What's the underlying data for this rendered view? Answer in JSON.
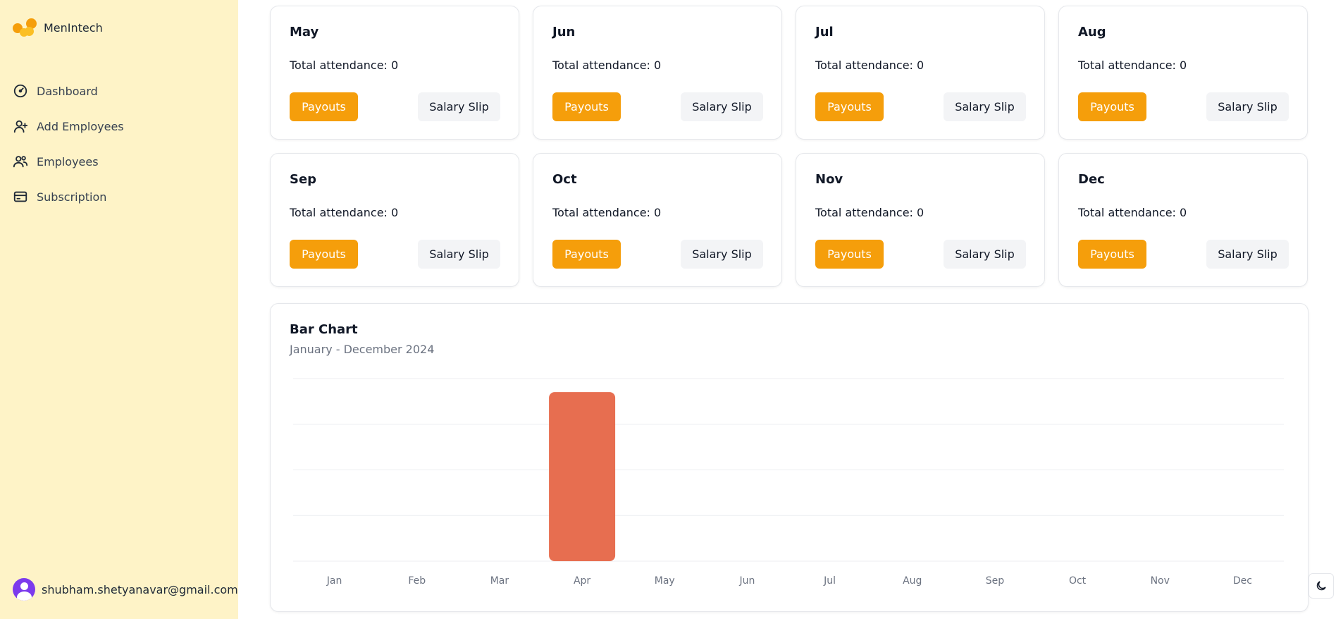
{
  "app": {
    "name": "MenIntech"
  },
  "sidebar": {
    "items": [
      {
        "label": "Dashboard",
        "icon": "gauge-icon"
      },
      {
        "label": "Add Employees",
        "icon": "user-plus-icon"
      },
      {
        "label": "Employees",
        "icon": "users-icon"
      },
      {
        "label": "Subscription",
        "icon": "credit-card-icon"
      }
    ],
    "user_email": "shubham.shetyanavar@gmail.com"
  },
  "months": [
    {
      "name": "May",
      "attendance": "Total attendance: 0",
      "payouts": "Payouts",
      "slip": "Salary Slip"
    },
    {
      "name": "Jun",
      "attendance": "Total attendance: 0",
      "payouts": "Payouts",
      "slip": "Salary Slip"
    },
    {
      "name": "Jul",
      "attendance": "Total attendance: 0",
      "payouts": "Payouts",
      "slip": "Salary Slip"
    },
    {
      "name": "Aug",
      "attendance": "Total attendance: 0",
      "payouts": "Payouts",
      "slip": "Salary Slip"
    },
    {
      "name": "Sep",
      "attendance": "Total attendance: 0",
      "payouts": "Payouts",
      "slip": "Salary Slip"
    },
    {
      "name": "Oct",
      "attendance": "Total attendance: 0",
      "payouts": "Payouts",
      "slip": "Salary Slip"
    },
    {
      "name": "Nov",
      "attendance": "Total attendance: 0",
      "payouts": "Payouts",
      "slip": "Salary Slip"
    },
    {
      "name": "Dec",
      "attendance": "Total attendance: 0",
      "payouts": "Payouts",
      "slip": "Salary Slip"
    }
  ],
  "colors": {
    "accent": "#f59e0b",
    "sidebar_bg": "#fef3c7",
    "bar": "#e76e50",
    "avatar": "#7c3aed"
  },
  "chart_data": {
    "type": "bar",
    "title": "Bar Chart",
    "subtitle": "January - December 2024",
    "categories": [
      "Jan",
      "Feb",
      "Mar",
      "Apr",
      "May",
      "Jun",
      "Jul",
      "Aug",
      "Sep",
      "Oct",
      "Nov",
      "Dec"
    ],
    "values": [
      0,
      0,
      0,
      1,
      0,
      0,
      0,
      0,
      0,
      0,
      0,
      0
    ],
    "ylim": [
      0,
      1.08
    ],
    "grid": true,
    "bar_color": "#e76e50"
  },
  "theme_toggle": {
    "icon": "moon-icon"
  }
}
